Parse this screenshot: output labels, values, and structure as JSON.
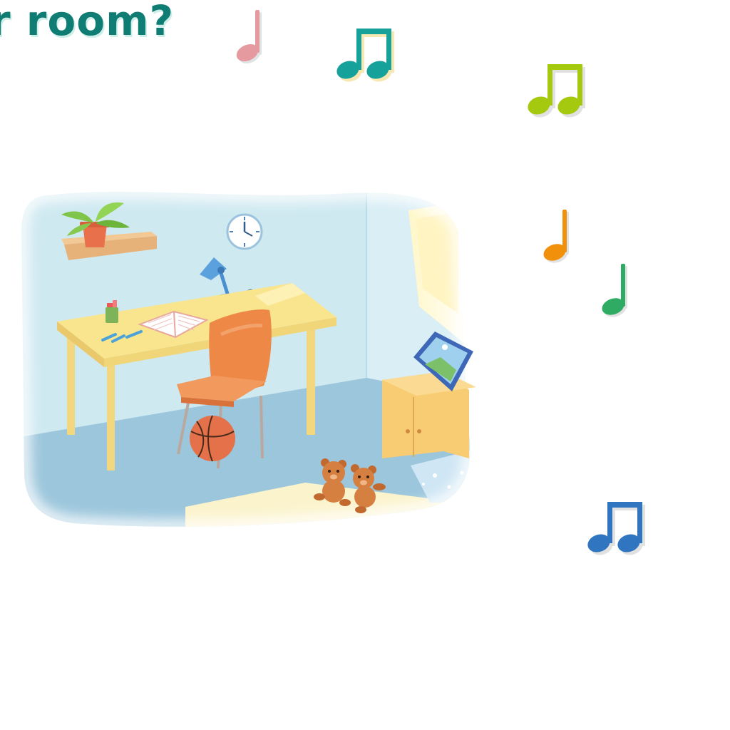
{
  "title": "r room?",
  "colors": {
    "title": "#0f7d73",
    "notes": [
      "#e59aa0",
      "#17a19b",
      "#a5c90f",
      "#f0900b",
      "#2fab63",
      "#2f75c0"
    ],
    "wall": "#cfe9f1",
    "floor": "#9cc6dc",
    "desk": "#f9e58e",
    "chair": "#ee8846",
    "basketball": "#e4714a",
    "cabinet": "#f8cc72",
    "teddy": "#d57f40"
  },
  "scene": {
    "objects": [
      "plant",
      "wall-shelf",
      "clock",
      "desk-lamp",
      "pen-cup",
      "open-book",
      "pens",
      "desk",
      "chair",
      "basketball",
      "cabinet",
      "picture-frame",
      "window",
      "teddy-bears",
      "rug"
    ]
  }
}
